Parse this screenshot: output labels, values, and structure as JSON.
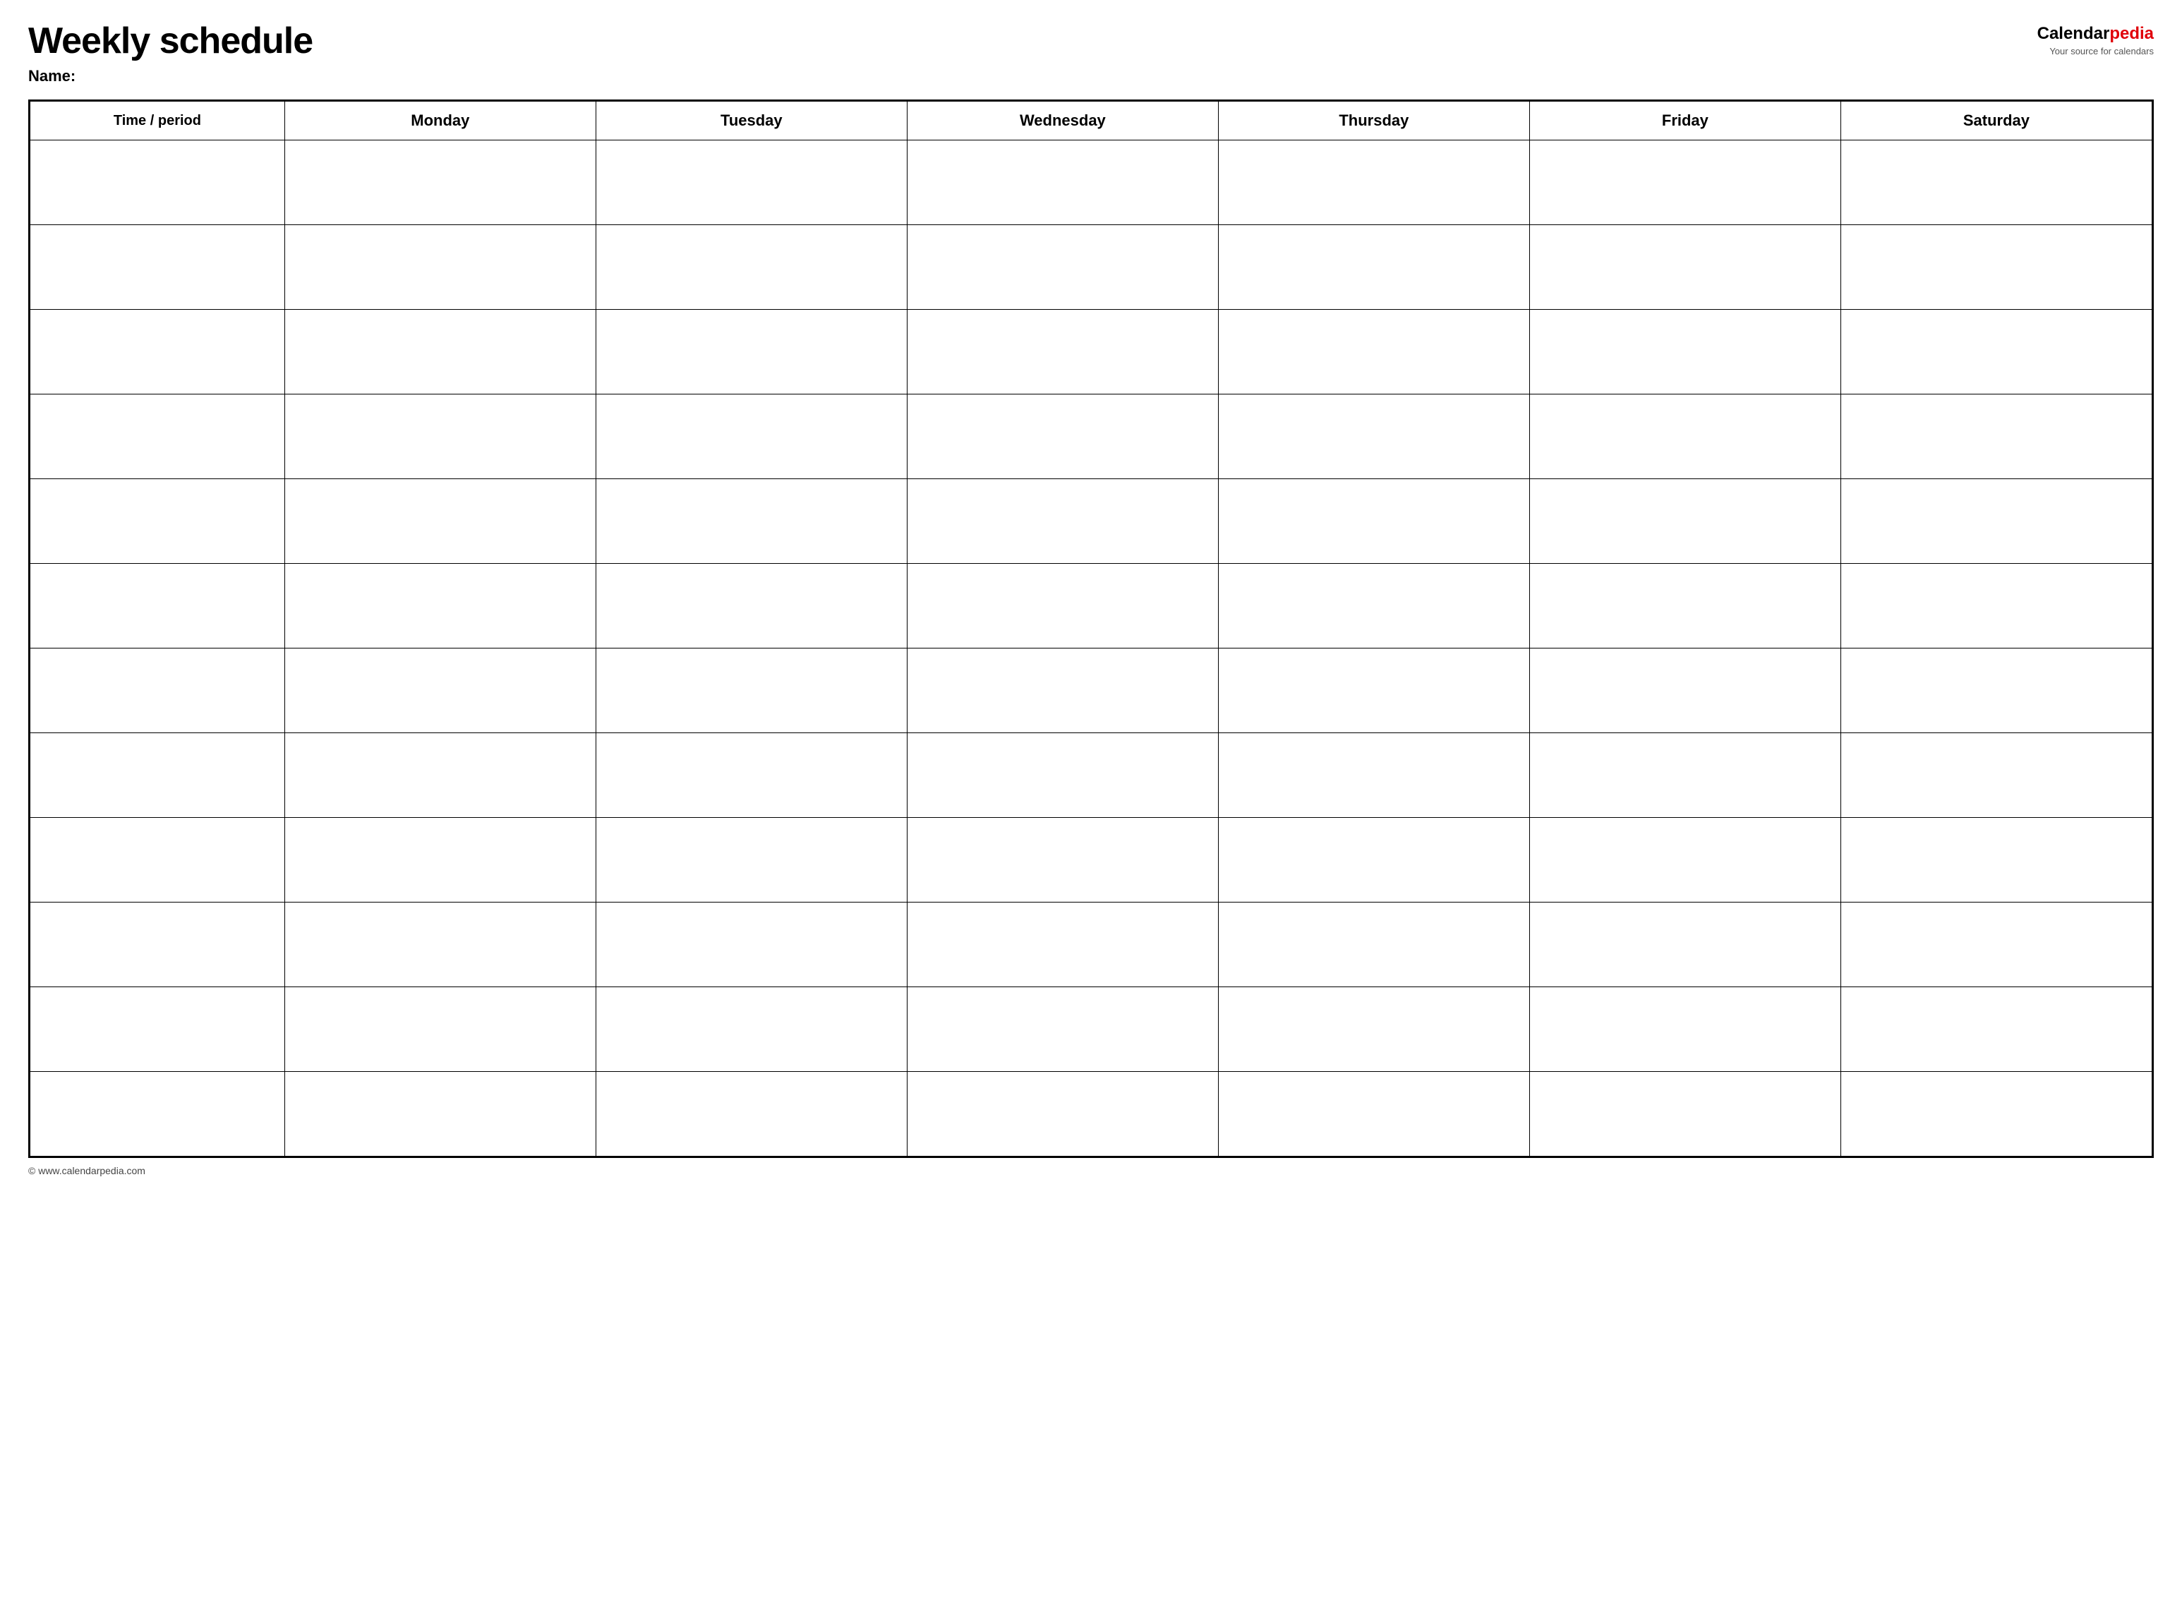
{
  "header": {
    "title": "Weekly schedule",
    "name_label": "Name:",
    "logo_part1": "Calendar",
    "logo_part2": "pedia",
    "logo_tagline": "Your source for calendars",
    "footer_url": "© www.calendarpedia.com"
  },
  "table": {
    "columns": [
      {
        "label": "Time / period"
      },
      {
        "label": "Monday"
      },
      {
        "label": "Tuesday"
      },
      {
        "label": "Wednesday"
      },
      {
        "label": "Thursday"
      },
      {
        "label": "Friday"
      },
      {
        "label": "Saturday"
      }
    ],
    "row_count": 12
  }
}
